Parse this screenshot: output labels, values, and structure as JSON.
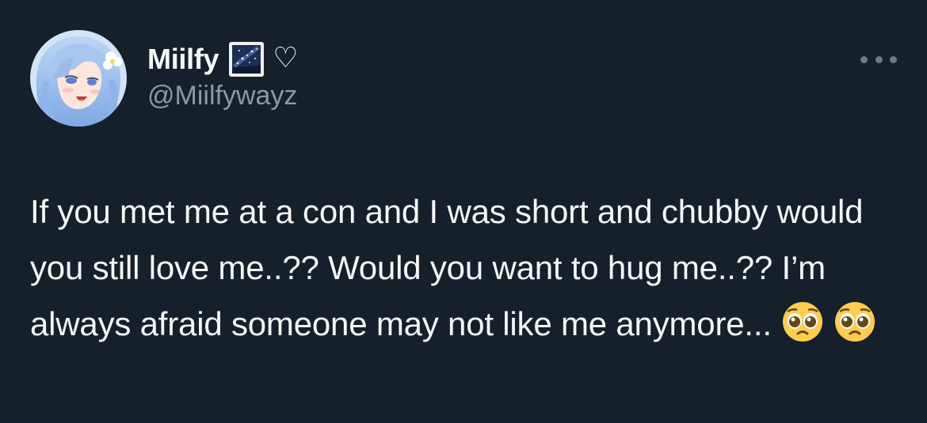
{
  "tweet": {
    "display_name": "Miilfy",
    "name_emoji_icon": "night-sky-emoji-icon",
    "heart_symbol": "♡",
    "handle": "@Miilfywayz",
    "text": "If you met me at a con and I was short and chubby would you still love me..?? Would you want to hug me..?? I’m always afraid someone may not like me anymore...",
    "emojis": [
      "pleading-face-emoji-icon",
      "pleading-face-emoji-icon"
    ],
    "more_icon": "more-options-icon"
  },
  "colors": {
    "background": "#15202b",
    "primary_text": "#f7f9f9",
    "secondary_text": "#8b98a5"
  }
}
